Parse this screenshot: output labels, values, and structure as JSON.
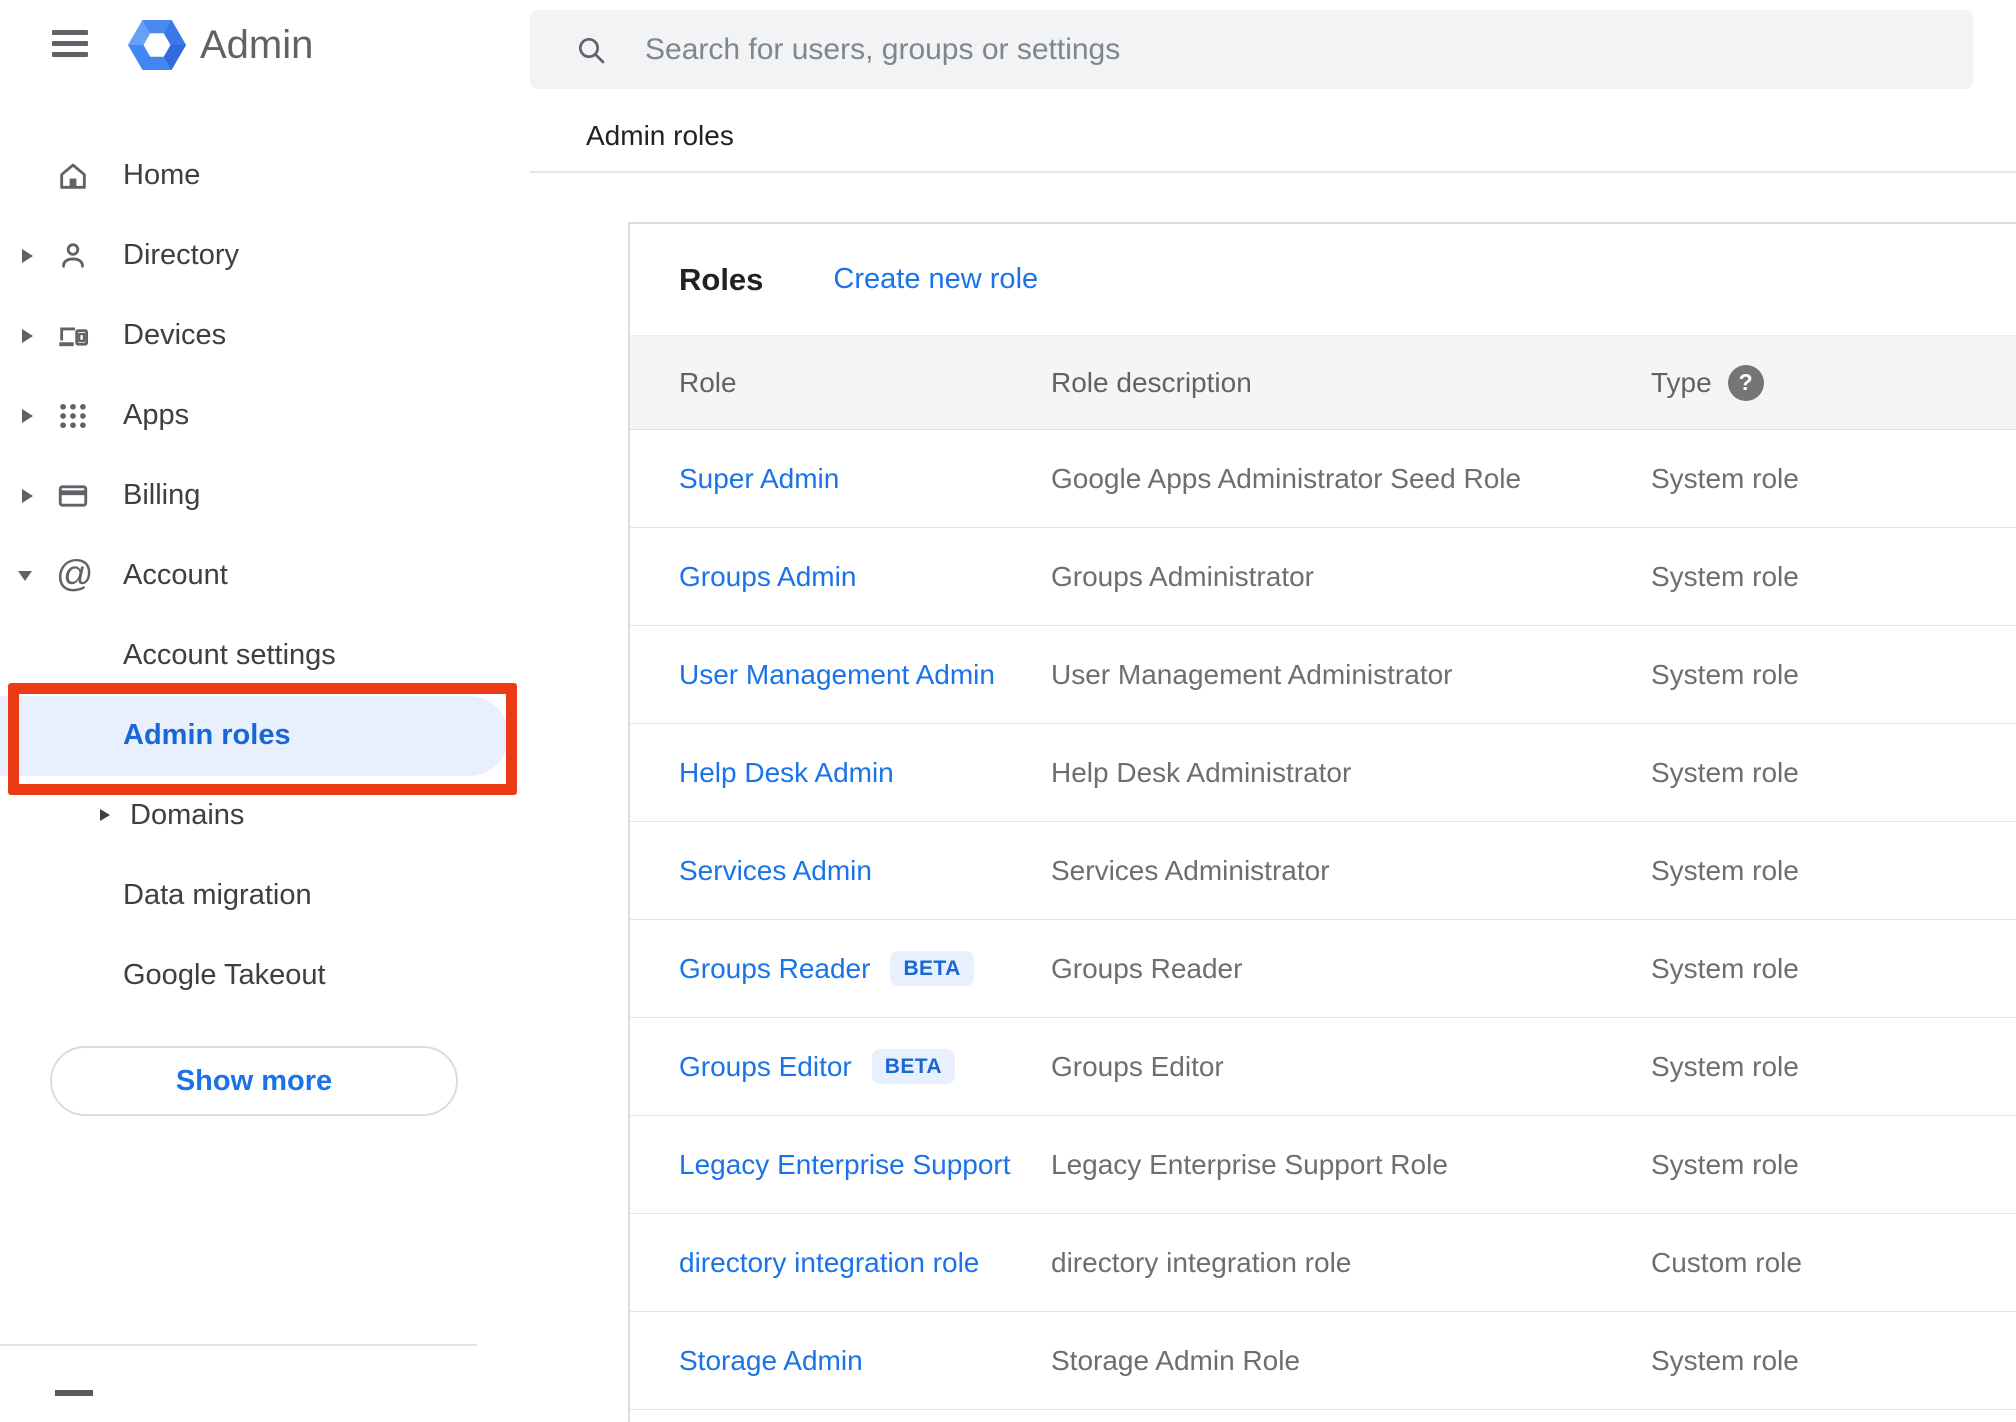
{
  "app": {
    "logo_text": "Admin",
    "colors": {
      "link_blue": "#1a73e8",
      "selected_blue": "#1967d2",
      "selected_bg": "#e8f0fe",
      "beta_bg": "#e8f0fe",
      "beta_text": "#1867d3",
      "annotation_red": "#ea3b16",
      "search_bg": "#f1f3f4",
      "table_header_bg": "#f5f5f5",
      "icon_gray": "#5f6368",
      "logo_blue": "#4285f4"
    }
  },
  "sidebar": {
    "nav": [
      {
        "label": "Home",
        "icon": "home-icon",
        "expander": null,
        "level": 0,
        "selected": false
      },
      {
        "label": "Directory",
        "icon": "person-icon",
        "expander": "collapsed",
        "level": 0,
        "selected": false
      },
      {
        "label": "Devices",
        "icon": "devices-icon",
        "expander": "collapsed",
        "level": 0,
        "selected": false
      },
      {
        "label": "Apps",
        "icon": "apps-grid-icon",
        "expander": "collapsed",
        "level": 0,
        "selected": false
      },
      {
        "label": "Billing",
        "icon": "credit-card-icon",
        "expander": "collapsed",
        "level": 0,
        "selected": false
      },
      {
        "label": "Account",
        "icon": "at-sign-icon",
        "expander": "expanded",
        "level": 0,
        "selected": false
      },
      {
        "label": "Account settings",
        "icon": null,
        "expander": null,
        "level": 1,
        "selected": false
      },
      {
        "label": "Admin roles",
        "icon": null,
        "expander": null,
        "level": 1,
        "selected": true
      },
      {
        "label": "Domains",
        "icon": null,
        "expander": "collapsed",
        "level": 1,
        "selected": false
      },
      {
        "label": "Data migration",
        "icon": null,
        "expander": null,
        "level": 1,
        "selected": false
      },
      {
        "label": "Google Takeout",
        "icon": null,
        "expander": null,
        "level": 1,
        "selected": false
      }
    ],
    "show_more_label": "Show more",
    "annotation": "red box highlighting Admin roles item"
  },
  "search": {
    "placeholder": "Search for users, groups or settings",
    "icon": "search-icon"
  },
  "breadcrumb": "Admin roles",
  "roles_card": {
    "title": "Roles",
    "create_link": "Create new role",
    "columns": {
      "role": "Role",
      "description": "Role description",
      "type": "Type",
      "type_help_icon": "help-icon"
    },
    "rows": [
      {
        "role": "Super Admin",
        "beta": false,
        "description": "Google Apps Administrator Seed Role",
        "type": "System role"
      },
      {
        "role": "Groups Admin",
        "beta": false,
        "description": "Groups Administrator",
        "type": "System role"
      },
      {
        "role": "User Management Admin",
        "beta": false,
        "description": "User Management Administrator",
        "type": "System role"
      },
      {
        "role": "Help Desk Admin",
        "beta": false,
        "description": "Help Desk Administrator",
        "type": "System role"
      },
      {
        "role": "Services Admin",
        "beta": false,
        "description": "Services Administrator",
        "type": "System role"
      },
      {
        "role": "Groups Reader",
        "beta": true,
        "beta_label": "BETA",
        "description": "Groups Reader",
        "type": "System role"
      },
      {
        "role": "Groups Editor",
        "beta": true,
        "beta_label": "BETA",
        "description": "Groups Editor",
        "type": "System role"
      },
      {
        "role": "Legacy Enterprise Support",
        "beta": false,
        "description": "Legacy Enterprise Support Role",
        "type": "System role"
      },
      {
        "role": "directory integration role",
        "beta": false,
        "description": "directory integration role",
        "type": "Custom role"
      },
      {
        "role": "Storage Admin",
        "beta": false,
        "description": "Storage Admin Role",
        "type": "System role"
      }
    ]
  }
}
